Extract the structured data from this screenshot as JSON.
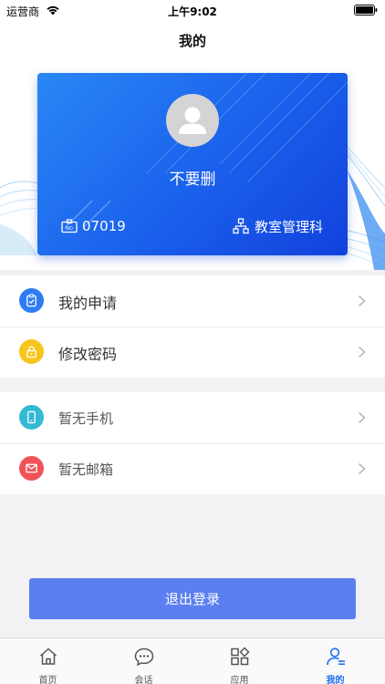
{
  "status_bar": {
    "carrier": "运营商",
    "time": "上午9:02"
  },
  "nav": {
    "title": "我的"
  },
  "profile": {
    "name": "不要删",
    "employee_id": "07019",
    "department": "教室管理科"
  },
  "menu_group_one": [
    {
      "label": "我的申请",
      "icon": "clipboard-check-icon",
      "color": "#2f7cf2"
    },
    {
      "label": "修改密码",
      "icon": "lock-icon",
      "color": "#f7c51c"
    }
  ],
  "menu_group_two": [
    {
      "label": "暂无手机",
      "icon": "mobile-phone-icon",
      "color": "#33b9d4"
    },
    {
      "label": "暂无邮箱",
      "icon": "mail-icon",
      "color": "#ef5358"
    }
  ],
  "logout": {
    "label": "退出登录",
    "color": "#5b7ef0"
  },
  "tabs": [
    {
      "label": "首页",
      "icon": "home-icon",
      "active": false
    },
    {
      "label": "会话",
      "icon": "chat-bubble-icon",
      "active": false
    },
    {
      "label": "应用",
      "icon": "apps-grid-icon",
      "active": false
    },
    {
      "label": "我的",
      "icon": "user-profile-icon",
      "active": true
    }
  ],
  "colors": {
    "accent": "#1f6ff0",
    "card_gradient_start": "#2a87f5",
    "card_gradient_end": "#1241dc"
  }
}
